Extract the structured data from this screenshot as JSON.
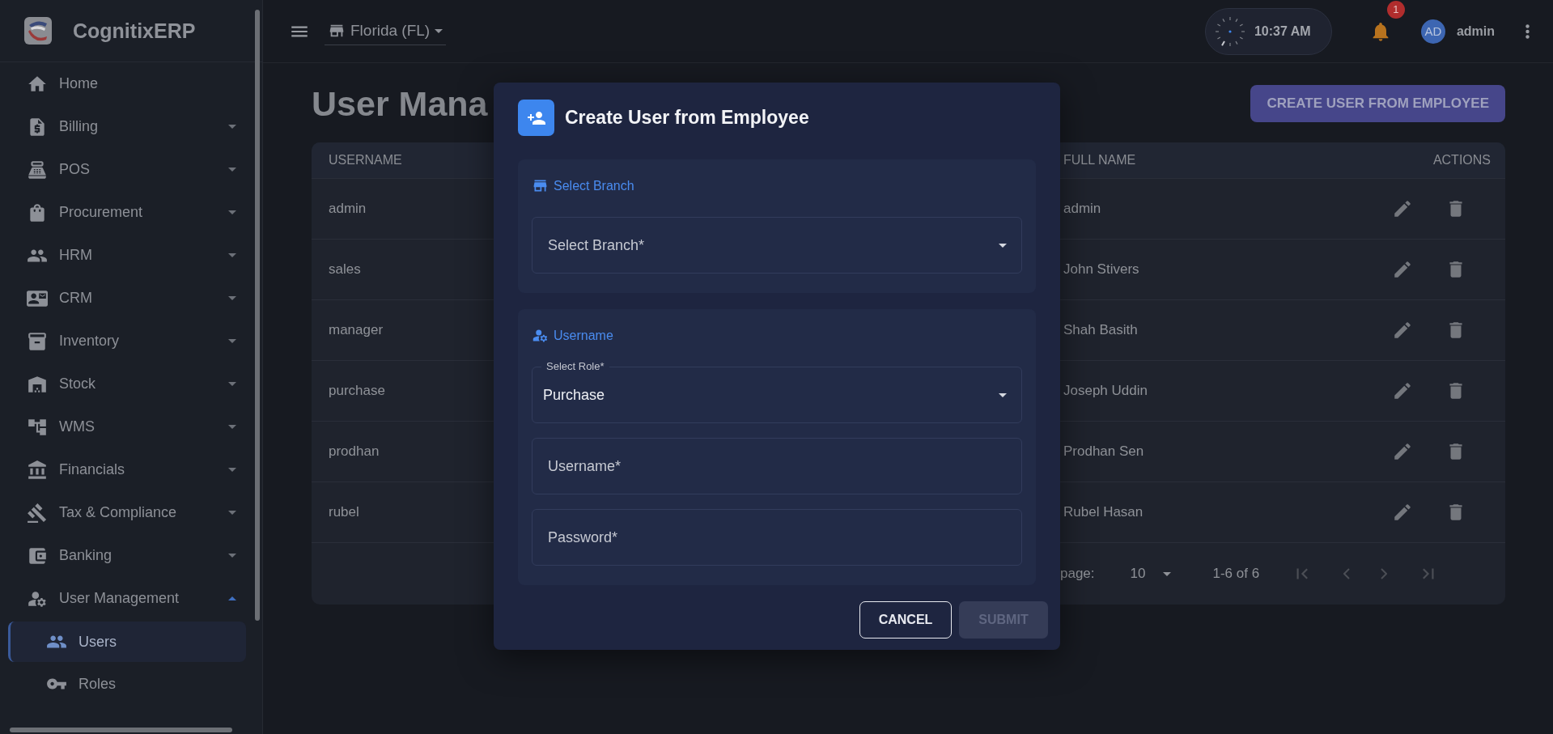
{
  "sidebar": {
    "brand": "CognitixERP",
    "items": [
      {
        "label": "Home",
        "kind": "link"
      },
      {
        "label": "Billing",
        "kind": "group",
        "expanded": false
      },
      {
        "label": "POS",
        "kind": "group",
        "expanded": false
      },
      {
        "label": "Procurement",
        "kind": "group",
        "expanded": false
      },
      {
        "label": "HRM",
        "kind": "group",
        "expanded": false
      },
      {
        "label": "CRM",
        "kind": "group",
        "expanded": false
      },
      {
        "label": "Inventory",
        "kind": "group",
        "expanded": false
      },
      {
        "label": "Stock",
        "kind": "group",
        "expanded": false
      },
      {
        "label": "WMS",
        "kind": "group",
        "expanded": false
      },
      {
        "label": "Financials",
        "kind": "group",
        "expanded": false
      },
      {
        "label": "Tax & Compliance",
        "kind": "group",
        "expanded": false
      },
      {
        "label": "Banking",
        "kind": "group",
        "expanded": false
      },
      {
        "label": "User Management",
        "kind": "group",
        "expanded": true,
        "children": [
          {
            "label": "Users",
            "selected": true
          },
          {
            "label": "Roles",
            "selected": false
          }
        ]
      }
    ]
  },
  "topbar": {
    "branch": "Florida (FL)",
    "time": "10:37 AM",
    "notification_count": "1",
    "avatar_initials": "AD",
    "user": "admin"
  },
  "page": {
    "title": "User Mana",
    "create_button": "CREATE USER FROM EMPLOYEE"
  },
  "table": {
    "columns": [
      "USERNAME",
      "FULL NAME",
      "ACTIONS"
    ],
    "rows": [
      {
        "username": "admin",
        "full_name": "admin"
      },
      {
        "username": "sales",
        "full_name": "John Stivers"
      },
      {
        "username": "manager",
        "full_name": "Shah Basith"
      },
      {
        "username": "purchase",
        "full_name": "Joseph Uddin"
      },
      {
        "username": "prodhan",
        "full_name": "Prodhan Sen"
      },
      {
        "username": "rubel",
        "full_name": "Rubel Hasan"
      }
    ],
    "pagination": {
      "rows_per_page_label": "page:",
      "rows_per_page": "10",
      "range": "1-6 of 6"
    }
  },
  "dialog": {
    "title": "Create User from Employee",
    "sections": [
      {
        "kind": "branch",
        "heading": "Select Branch",
        "fields": [
          {
            "kind": "select",
            "placeholder": "Select Branch*"
          }
        ]
      },
      {
        "kind": "user",
        "heading": "Username",
        "fields": [
          {
            "kind": "select",
            "label": "Select Role*",
            "value": "Purchase"
          },
          {
            "kind": "input",
            "placeholder": "Username*"
          },
          {
            "kind": "input",
            "placeholder": "Password*"
          }
        ]
      }
    ],
    "buttons": [
      {
        "label": "CANCEL",
        "kind": "outline",
        "disabled": false
      },
      {
        "label": "SUBMIT",
        "kind": "filled",
        "disabled": true
      }
    ]
  }
}
